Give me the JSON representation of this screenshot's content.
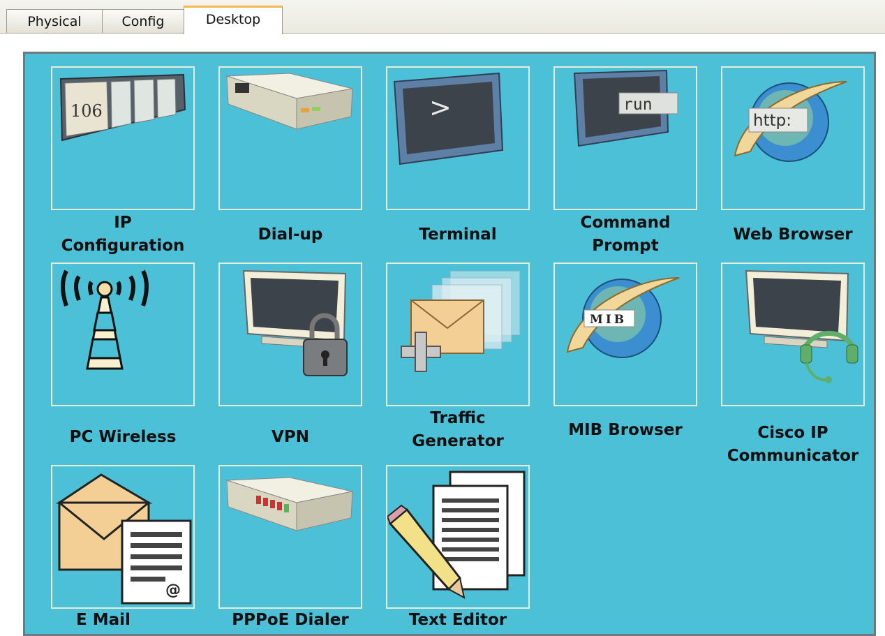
{
  "tabs": [
    {
      "label": "Physical",
      "active": false
    },
    {
      "label": "Config",
      "active": false
    },
    {
      "label": "Desktop",
      "active": true
    }
  ],
  "colors": {
    "panel": "#4cc0d7",
    "tab_accent": "#f3b84c"
  },
  "apps": [
    {
      "id": "ip-configuration",
      "label": "IP Configuration",
      "label_lines": [
        "IP",
        "Configuration"
      ],
      "icon": "ip-config-icon",
      "icon_text": "106"
    },
    {
      "id": "dial-up",
      "label": "Dial-up",
      "label_lines": [
        "Dial-up"
      ],
      "icon": "modem-icon"
    },
    {
      "id": "terminal",
      "label": "Terminal",
      "label_lines": [
        "Terminal"
      ],
      "icon": "terminal-icon",
      "icon_text": ">"
    },
    {
      "id": "command-prompt",
      "label": "Command Prompt",
      "label_lines": [
        "Command",
        "Prompt"
      ],
      "icon": "command-prompt-icon",
      "icon_text": "run"
    },
    {
      "id": "web-browser",
      "label": "Web Browser",
      "label_lines": [
        "Web Browser"
      ],
      "icon": "web-browser-icon",
      "icon_text": "http:"
    },
    {
      "id": "pc-wireless",
      "label": "PC Wireless",
      "label_lines": [
        "PC Wireless"
      ],
      "icon": "wireless-tower-icon"
    },
    {
      "id": "vpn",
      "label": "VPN",
      "label_lines": [
        "VPN"
      ],
      "icon": "vpn-lock-icon"
    },
    {
      "id": "traffic-generator",
      "label": "Traffic Generator",
      "label_lines": [
        "Traffic",
        "Generator"
      ],
      "icon": "traffic-generator-icon"
    },
    {
      "id": "mib-browser",
      "label": "MIB Browser",
      "label_lines": [
        "MIB Browser"
      ],
      "icon": "mib-browser-icon",
      "icon_text": "MIB"
    },
    {
      "id": "cisco-ip-communicator",
      "label": "Cisco IP Communicator",
      "label_lines": [
        "Cisco IP",
        "Communicator"
      ],
      "icon": "ip-communicator-icon"
    },
    {
      "id": "e-mail",
      "label": "E Mail",
      "label_lines": [
        "E Mail"
      ],
      "icon": "email-icon",
      "icon_text": "@"
    },
    {
      "id": "pppoe-dialer",
      "label": "PPPoE Dialer",
      "label_lines": [
        "PPPoE Dialer"
      ],
      "icon": "pppoe-dialer-icon"
    },
    {
      "id": "text-editor",
      "label": "Text Editor",
      "label_lines": [
        "Text Editor"
      ],
      "icon": "text-editor-icon"
    }
  ]
}
